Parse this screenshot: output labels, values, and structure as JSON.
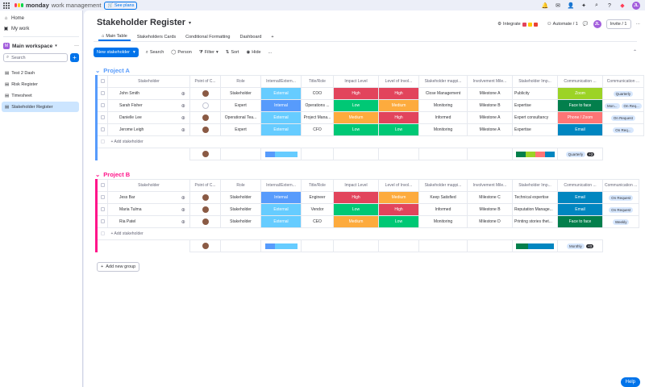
{
  "topbar": {
    "brand": "monday",
    "product": "work management",
    "see_plans": "See plans",
    "user_initials": "JL"
  },
  "sidebar": {
    "home": "Home",
    "my_work": "My work",
    "workspace_badge": "M",
    "workspace": "Main workspace",
    "search_placeholder": "Search",
    "boards": [
      "Test 2 Dash",
      "Risk Register",
      "Timesheet",
      "Stakeholder Register"
    ]
  },
  "board": {
    "title": "Stakeholder Register",
    "integrate": "Integrate",
    "automate": "Automate / 1",
    "invite": "Invite / 1",
    "avatar": "JL",
    "tabs": [
      "Main Table",
      "Stakeholders Cards",
      "Conditional Formatting",
      "Dashboard"
    ],
    "add_tab": "+"
  },
  "toolbar": {
    "new_item": "New stakeholder",
    "search": "Search",
    "person": "Person",
    "filter": "Filter",
    "sort": "Sort",
    "hide": "Hide",
    "more": "..."
  },
  "columns": [
    "Stakeholder",
    "Point of C...",
    "Role",
    "Internal/Extern...",
    "Title/Role",
    "Impact Level",
    "Level of Invol...",
    "Stakeholder mappi...",
    "Involvement Mile...",
    "Stakeholder Imp...",
    "Communication ...",
    "Communication ..."
  ],
  "colors": {
    "internal": "#579bfc",
    "external": "#66ccff",
    "high": "#e2445c",
    "medium": "#fdab3d",
    "low": "#00c875",
    "comm_zoom": "#9cd326",
    "comm_face": "#037f4c",
    "comm_phone": "#ff7575",
    "comm_email": "#0086c0",
    "group_a": "#579bfc",
    "group_b": "#ff158a"
  },
  "groups": [
    {
      "name": "Project A",
      "rows": [
        {
          "name": "John Smith",
          "person": true,
          "role": "Stakeholder",
          "ie": "External",
          "title": "COO",
          "impact": "High",
          "involvement": "High",
          "mapping": "Close Management",
          "milestone": "Milestone A",
          "importance": "Publicity",
          "comm": "Zoom",
          "freq": [
            "Quarterly"
          ]
        },
        {
          "name": "Sarah Fisher",
          "person": false,
          "role": "Expert",
          "ie": "Internal",
          "title": "Operations ...",
          "impact": "Low",
          "involvement": "Medium",
          "mapping": "Monitoring",
          "milestone": "Milestone B",
          "importance": "Expertise",
          "comm": "Face to face",
          "freq": [
            "Mon...",
            "On Req..."
          ]
        },
        {
          "name": "Danielle Lee",
          "person": true,
          "role": "Operational Tea...",
          "ie": "External",
          "title": "Project Mana...",
          "impact": "Medium",
          "involvement": "High",
          "mapping": "Informed",
          "milestone": "Milestone A",
          "importance": "Expert consultancy",
          "comm": "Phone / Zoom",
          "freq": [
            "On Request"
          ]
        },
        {
          "name": "Jerome Leigh",
          "person": true,
          "role": "Expert",
          "ie": "External",
          "title": "CFO",
          "impact": "Low",
          "involvement": "Low",
          "mapping": "Monitoring",
          "milestone": "Milestone A",
          "importance": "Expertise",
          "comm": "Email",
          "freq": [
            "On Req..."
          ]
        }
      ],
      "add_item": "+ Add stakeholder",
      "summary_freq": "Quarterly",
      "summary_count": "+2"
    },
    {
      "name": "Project B",
      "rows": [
        {
          "name": "Jess Bar",
          "person": true,
          "role": "Stakeholder",
          "ie": "Internal",
          "title": "Engineer",
          "impact": "High",
          "involvement": "Medium",
          "mapping": "Keep Satisfied",
          "milestone": "Milestone C",
          "importance": "Technical expertise",
          "comm": "Email",
          "freq": [
            "On Request"
          ]
        },
        {
          "name": "Maria Tulma",
          "person": true,
          "role": "Stakeholder",
          "ie": "External",
          "title": "Vendor",
          "impact": "Low",
          "involvement": "High",
          "mapping": "Informed",
          "milestone": "Milestone B",
          "importance": "Reputation Manage...",
          "comm": "Email",
          "freq": [
            "On Request"
          ]
        },
        {
          "name": "Ria Patel",
          "person": true,
          "role": "Stakeholder",
          "ie": "External",
          "title": "CEO",
          "impact": "Medium",
          "involvement": "Low",
          "mapping": "Monitoring",
          "milestone": "Milestone D",
          "importance": "Printing stories thet...",
          "comm": "Face to face",
          "freq": [
            "Weekly"
          ]
        }
      ],
      "add_item": "+ Add stakeholder",
      "summary_freq": "Monthly",
      "summary_count": "+3"
    }
  ],
  "add_group": "Add new group",
  "help": "Help"
}
